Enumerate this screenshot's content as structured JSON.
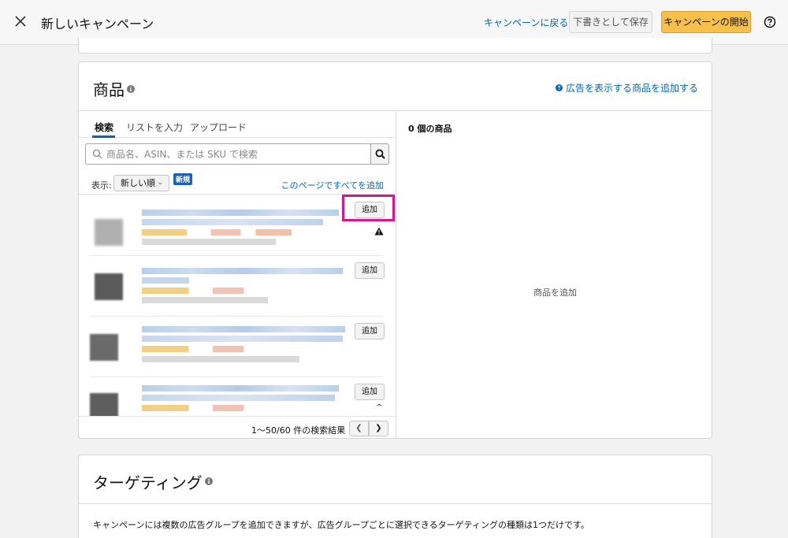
{
  "header": {
    "title": "新しいキャンペーン",
    "back_link": "キャンペーンに戻る",
    "save_draft": "下書きとして保存",
    "start_campaign": "キャンペーンの開始"
  },
  "products": {
    "title": "商品",
    "help_link": "広告を表示する商品を追加する",
    "tabs": [
      "検索",
      "リストを入力",
      "アップロード"
    ],
    "search_placeholder": "商品名、ASIN、または SKU で検索",
    "sort_label": "表示:",
    "sort_value": "新しい順",
    "new_badge": "新規",
    "add_all_link": "このページですべてを追加",
    "add_button_labels": [
      "追加",
      "追加",
      "追加",
      "追加"
    ],
    "pagination": "1〜50/60 件の検索結果",
    "selected_count": "0 個の商品",
    "empty_state": "商品を追加"
  },
  "targeting": {
    "title": "ターゲティング",
    "description": "キャンペーンには複数の広告グループを追加できますが、広告グループごとに選択できるターゲティングの種類は1つだけです。"
  },
  "colors": {
    "link": "#0066c0",
    "primary_button": "#f7c04a",
    "highlight": "#d3198c",
    "badge": "#1c63b8"
  },
  "icons": [
    "close-icon",
    "help-circle-icon",
    "info-icon",
    "search-icon",
    "chevron-down-icon",
    "warning-icon",
    "chevron-left-icon",
    "chevron-right-icon",
    "chevron-up-icon"
  ]
}
